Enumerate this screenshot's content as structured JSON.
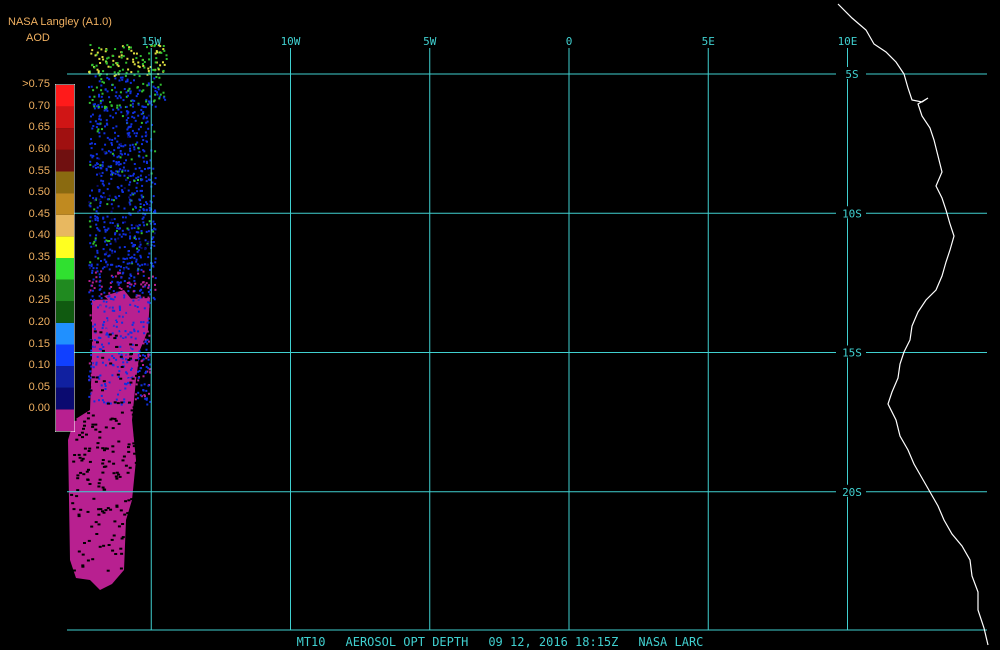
{
  "legend": {
    "source": "NASA Langley (A1.0)",
    "unit": "AOD",
    "levels": [
      {
        "label": ">0.75",
        "color": "#ff1a1a"
      },
      {
        "label": "0.70",
        "color": "#d01515"
      },
      {
        "label": "0.65",
        "color": "#a01010"
      },
      {
        "label": "0.60",
        "color": "#701010"
      },
      {
        "label": "0.55",
        "color": "#8a6a10"
      },
      {
        "label": "0.50",
        "color": "#c08a20"
      },
      {
        "label": "0.45",
        "color": "#e8b860"
      },
      {
        "label": "0.40",
        "color": "#ffff20"
      },
      {
        "label": "0.35",
        "color": "#30e030"
      },
      {
        "label": "0.30",
        "color": "#208a20"
      },
      {
        "label": "0.25",
        "color": "#105a10"
      },
      {
        "label": "0.20",
        "color": "#2090ff"
      },
      {
        "label": "0.15",
        "color": "#1040ff"
      },
      {
        "label": "0.10",
        "color": "#1020a0"
      },
      {
        "label": "0.05",
        "color": "#0a0a70"
      },
      {
        "label": "0.00",
        "color": "#b82090"
      }
    ]
  },
  "grid": {
    "longitudes": [
      {
        "label": "15W",
        "value": -15
      },
      {
        "label": "10W",
        "value": -10
      },
      {
        "label": "5W",
        "value": -5
      },
      {
        "label": "0",
        "value": 0
      },
      {
        "label": "5E",
        "value": 5
      },
      {
        "label": "10E",
        "value": 10
      }
    ],
    "latitudes": [
      {
        "label": "5S",
        "value": -5
      },
      {
        "label": "10S",
        "value": -10
      },
      {
        "label": "15S",
        "value": -15
      },
      {
        "label": "20S",
        "value": -20
      }
    ],
    "color": "#40d0d0"
  },
  "caption": {
    "product": "MT10",
    "field": "AEROSOL OPT DEPTH",
    "datetime": "09 12, 2016 18:15Z",
    "source": "NASA LARC"
  },
  "coastline_color": "#ffffff",
  "aod_colors": {
    "low": "#b82090",
    "blue": "#1030e0",
    "dark_blue": "#0a0a70",
    "green": "#30c030",
    "yellow": "#e0e040"
  }
}
